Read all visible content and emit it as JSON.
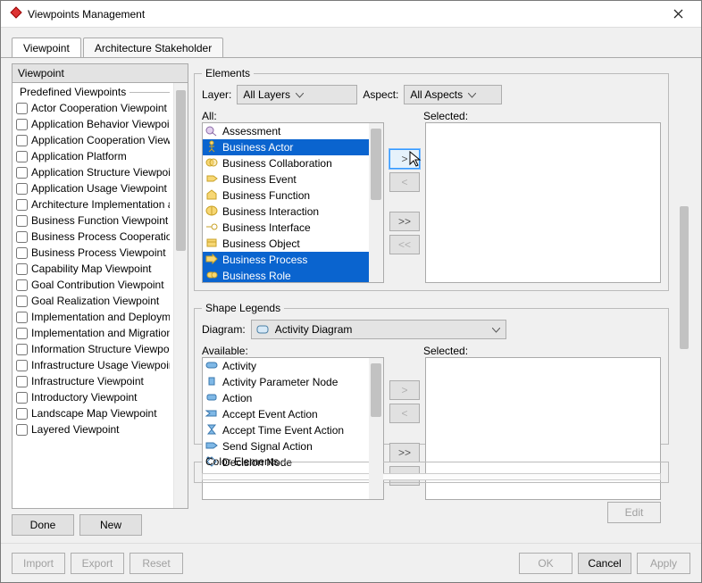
{
  "window": {
    "title": "Viewpoints Management"
  },
  "tabs": {
    "viewpoint": "Viewpoint",
    "stakeholder": "Architecture Stakeholder"
  },
  "left": {
    "heading": "Viewpoint",
    "fieldset": "Predefined Viewpoints",
    "items": [
      "Actor Cooperation Viewpoint",
      "Application Behavior Viewpoint",
      "Application Cooperation Viewp...",
      "Application Platform",
      "Application Structure Viewpoint",
      "Application Usage Viewpoint",
      "Architecture Implementation an...",
      "Business Function Viewpoint",
      "Business Process Cooperation...",
      "Business Process Viewpoint",
      "Capability Map Viewpoint",
      "Goal Contribution Viewpoint",
      "Goal Realization Viewpoint",
      "Implementation and Deploymen...",
      "Implementation and Migration V...",
      "Information Structure Viewpoint",
      "Infrastructure Usage Viewpoint",
      "Infrastructure Viewpoint",
      "Introductory Viewpoint",
      "Landscape Map Viewpoint",
      "Layered Viewpoint"
    ],
    "done": "Done",
    "new": "New"
  },
  "elements": {
    "legend": "Elements",
    "layer_label": "Layer:",
    "layer_value": "All Layers",
    "aspect_label": "Aspect:",
    "aspect_value": "All Aspects",
    "all_label": "All:",
    "selected_label": "Selected:",
    "all_items": [
      {
        "text": "Assessment",
        "icon": "assessment",
        "selected": false
      },
      {
        "text": "Business Actor",
        "icon": "actor",
        "selected": true
      },
      {
        "text": "Business Collaboration",
        "icon": "collab",
        "selected": false
      },
      {
        "text": "Business Event",
        "icon": "event",
        "selected": false
      },
      {
        "text": "Business Function",
        "icon": "function",
        "selected": false
      },
      {
        "text": "Business Interaction",
        "icon": "interaction",
        "selected": false
      },
      {
        "text": "Business Interface",
        "icon": "interface",
        "selected": false
      },
      {
        "text": "Business Object",
        "icon": "object",
        "selected": false
      },
      {
        "text": "Business Process",
        "icon": "process",
        "selected": true
      },
      {
        "text": "Business Role",
        "icon": "role",
        "selected": true
      }
    ],
    "movers": {
      "add": ">",
      "remove": "<",
      "addall": ">>",
      "removeall": "<<"
    }
  },
  "shapes": {
    "legend": "Shape Legends",
    "diagram_label": "Diagram:",
    "diagram_value": "Activity Diagram",
    "available_label": "Available:",
    "selected_label": "Selected:",
    "items": [
      {
        "text": "Activity",
        "icon": "activity"
      },
      {
        "text": "Activity Parameter Node",
        "icon": "param"
      },
      {
        "text": "Action",
        "icon": "action"
      },
      {
        "text": "Accept Event Action",
        "icon": "accept"
      },
      {
        "text": "Accept Time Event Action",
        "icon": "time"
      },
      {
        "text": "Send Signal Action",
        "icon": "send"
      },
      {
        "text": "Decision Node",
        "icon": "decision"
      }
    ],
    "edit": "Edit"
  },
  "color": {
    "legend": "Color Elements"
  },
  "footer": {
    "import": "Import",
    "export": "Export",
    "reset": "Reset",
    "ok": "OK",
    "cancel": "Cancel",
    "apply": "Apply"
  }
}
